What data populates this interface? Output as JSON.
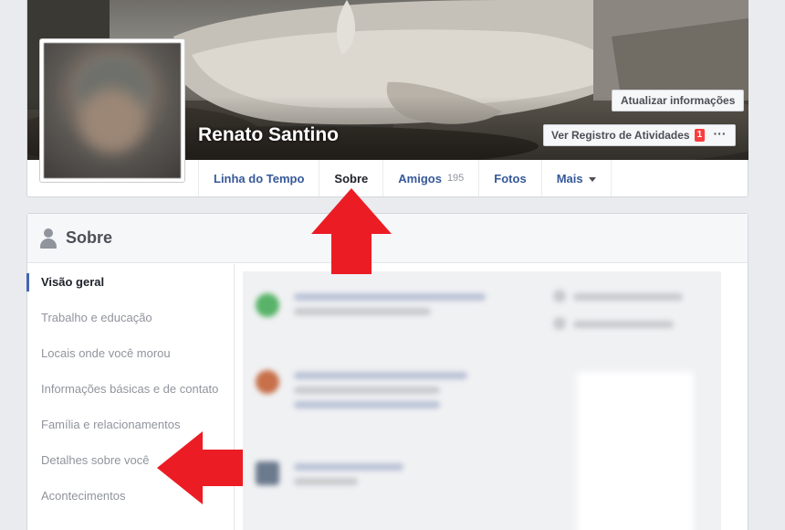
{
  "profile": {
    "name": "Renato Santino",
    "update_button": "Atualizar informações",
    "activity_button": "Ver Registro de Atividades",
    "activity_badge": "1",
    "more_button": "···"
  },
  "tabs": [
    {
      "label": "Linha do Tempo",
      "count": ""
    },
    {
      "label": "Sobre",
      "count": ""
    },
    {
      "label": "Amigos",
      "count": "195"
    },
    {
      "label": "Fotos",
      "count": ""
    },
    {
      "label": "Mais",
      "count": ""
    }
  ],
  "about": {
    "title": "Sobre",
    "nav": [
      "Visão geral",
      "Trabalho e educação",
      "Locais onde você morou",
      "Informações básicas e de contato",
      "Família e relacionamentos",
      "Detalhes sobre você",
      "Acontecimentos"
    ]
  },
  "colors": {
    "link": "#365899",
    "active_indicator": "#4267b2",
    "annotation_arrow": "#ec1c24",
    "badge": "#fa3e3e"
  }
}
